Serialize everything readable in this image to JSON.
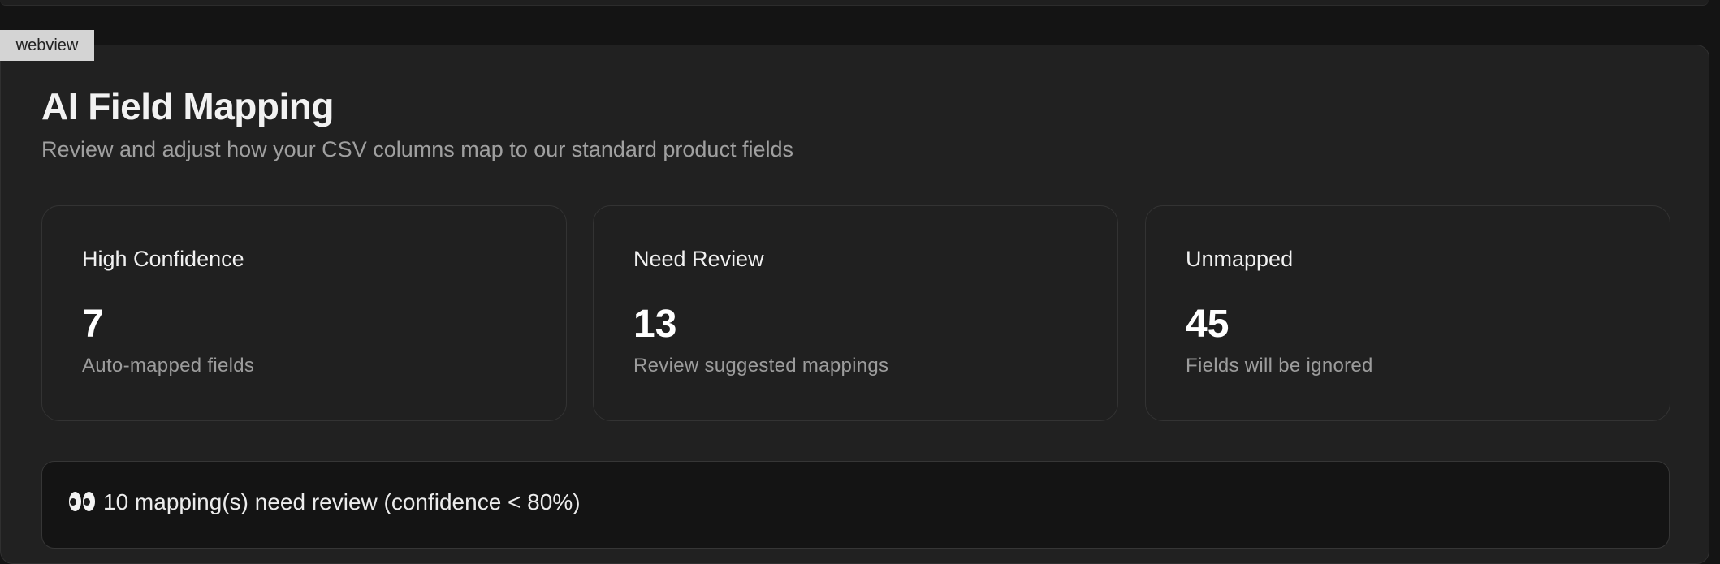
{
  "webview_tag": "webview",
  "header": {
    "title": "AI Field Mapping",
    "subtitle": "Review and adjust how your CSV columns map to our standard product fields"
  },
  "stats": [
    {
      "label": "High Confidence",
      "value": "7",
      "description": "Auto-mapped fields"
    },
    {
      "label": "Need Review",
      "value": "13",
      "description": "Review suggested mappings"
    },
    {
      "label": "Unmapped",
      "value": "45",
      "description": "Fields will be ignored"
    }
  ],
  "notice": {
    "icon": "eyes-icon",
    "text": "10 mapping(s) need review (confidence < 80%)"
  },
  "colors": {
    "background": "#141414",
    "panel": "#212121",
    "text_primary": "#f2f2f2",
    "text_secondary": "#a0a0a0"
  }
}
